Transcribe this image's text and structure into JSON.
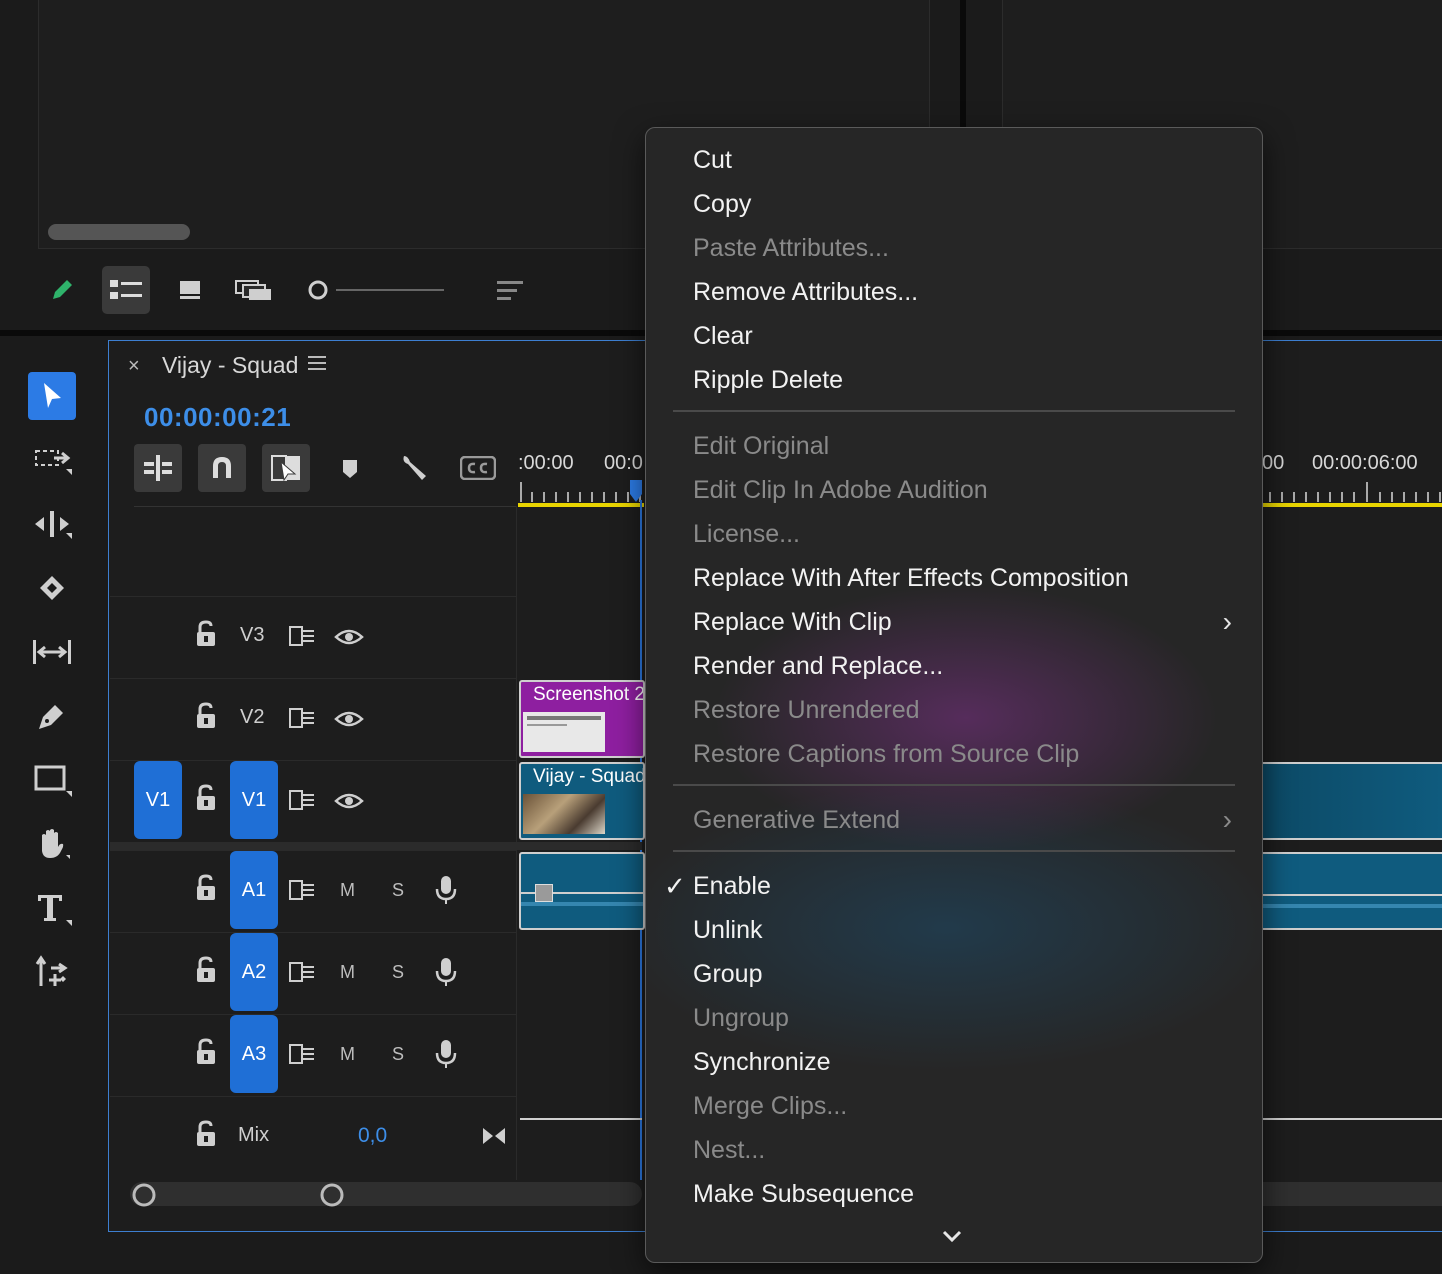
{
  "sequence": {
    "name": "Vijay - Squad",
    "timecode": "00:00:00:21"
  },
  "ruler": {
    "t0": ":00:00",
    "t1": "00:0",
    "t2": "00",
    "t3": "00:00:06:00"
  },
  "tracks": {
    "v3": "V3",
    "v2": "V2",
    "v1_source": "V1",
    "v1": "V1",
    "a1": "A1",
    "a2": "A2",
    "a3": "A3",
    "mute": "M",
    "solo": "S",
    "mix_label": "Mix",
    "mix_value": "0,0"
  },
  "clips": {
    "screenshot": "Screenshot 2",
    "video": "Vijay - Squad"
  },
  "context_menu": {
    "cut": "Cut",
    "copy": "Copy",
    "paste_attributes": "Paste Attributes...",
    "remove_attributes": "Remove Attributes...",
    "clear": "Clear",
    "ripple_delete": "Ripple Delete",
    "edit_original": "Edit Original",
    "edit_in_audition": "Edit Clip In Adobe Audition",
    "license": "License...",
    "replace_ae": "Replace With After Effects Composition",
    "replace_clip": "Replace With Clip",
    "render_replace": "Render and Replace...",
    "restore_unrendered": "Restore Unrendered",
    "restore_captions": "Restore Captions from Source Clip",
    "generative_extend": "Generative Extend",
    "enable": "Enable",
    "unlink": "Unlink",
    "group": "Group",
    "ungroup": "Ungroup",
    "synchronize": "Synchronize",
    "merge_clips": "Merge Clips...",
    "nest": "Nest...",
    "make_subsequence": "Make Subsequence",
    "check_glyph": "✓",
    "submenu_glyph": "›",
    "more_glyph": "⌄"
  },
  "colors": {
    "accent": "#1f6fd6",
    "timecode": "#3d8ee8",
    "clip_video": "#0f5b7e",
    "clip_graphic": "#8e1fa0",
    "work_area": "#e8d400"
  }
}
